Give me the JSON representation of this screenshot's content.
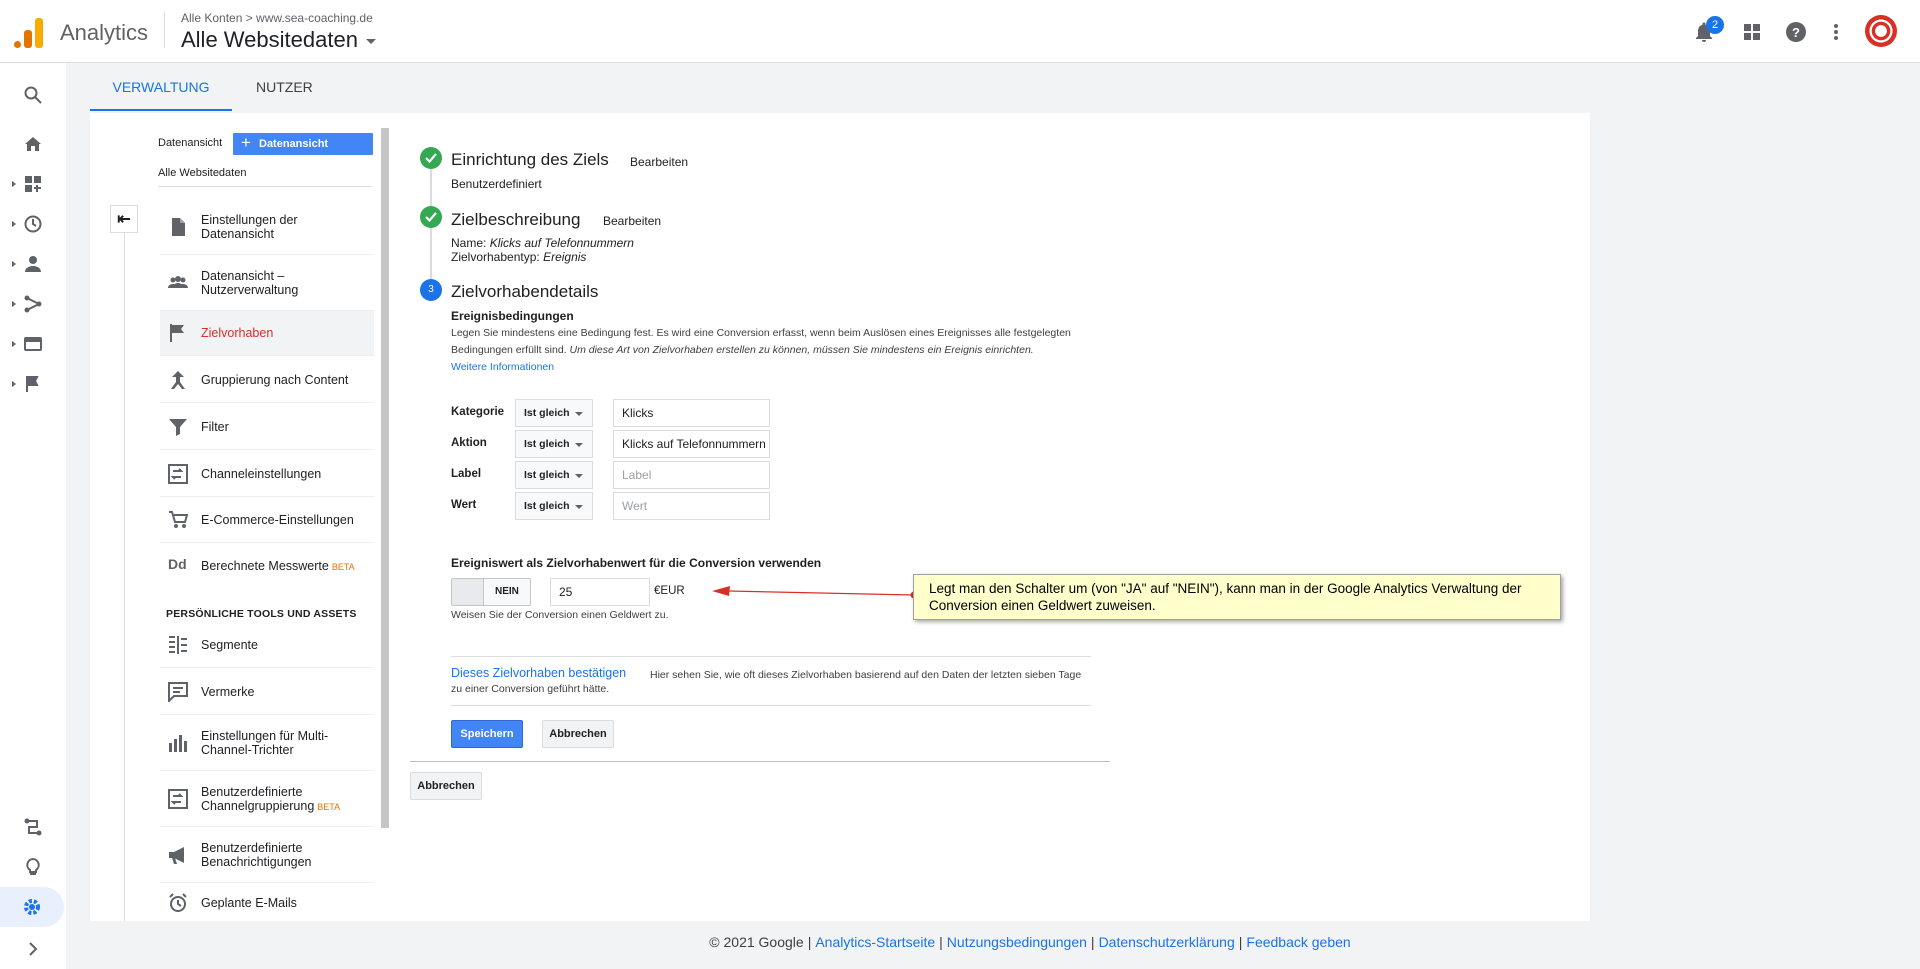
{
  "header": {
    "app_name": "Analytics",
    "breadcrumb": "Alle Konten > www.sea-coaching.de",
    "property": "Alle Websitedaten",
    "notification_count": "2"
  },
  "tabs": [
    {
      "label": "VERWALTUNG",
      "active": true
    },
    {
      "label": "NUTZER",
      "active": false
    }
  ],
  "leftnav": {
    "view_label": "Datenansicht",
    "create_button": "Datenansicht erstellen",
    "view_name": "Alle Websitedaten",
    "items": [
      {
        "label": "Einstellungen der Datenansicht",
        "icon": "document-icon"
      },
      {
        "label": "Datenansicht – Nutzerverwaltung",
        "icon": "people-icon"
      },
      {
        "label": "Zielvorhaben",
        "icon": "flag-icon",
        "active": true
      },
      {
        "label": "Gruppierung nach Content",
        "icon": "grouping-icon"
      },
      {
        "label": "Filter",
        "icon": "filter-icon"
      },
      {
        "label": "Channeleinstellungen",
        "icon": "channel-icon"
      },
      {
        "label": "E-Commerce-Einstellungen",
        "icon": "cart-icon"
      },
      {
        "label": "Berechnete Messwerte",
        "icon": "calculated-metrics-icon",
        "badge": "BETA"
      }
    ],
    "personal_heading": "PERSÖNLICHE TOOLS UND ASSETS",
    "personal_items": [
      {
        "label": "Segmente",
        "icon": "segments-icon"
      },
      {
        "label": "Vermerke",
        "icon": "annotations-icon"
      },
      {
        "label": "Einstellungen für Multi-Channel-Trichter",
        "icon": "bar-chart-icon"
      },
      {
        "label": "Benutzerdefinierte Channelgruppierung",
        "icon": "custom-channel-icon",
        "badge": "BETA"
      },
      {
        "label": "Benutzerdefinierte Benachrichtigungen",
        "icon": "megaphone-icon"
      },
      {
        "label": "Geplante E-Mails",
        "icon": "alarm-clock-icon"
      }
    ]
  },
  "main": {
    "step1": {
      "title": "Einrichtung des Ziels",
      "edit": "Bearbeiten",
      "value": "Benutzerdefiniert"
    },
    "step2": {
      "title": "Zielbeschreibung",
      "edit": "Bearbeiten",
      "name_label": "Name:",
      "name_value": "Klicks auf Telefonnummern",
      "type_label": "Zielvorhabentyp:",
      "type_value": "Ereignis"
    },
    "step3": {
      "number": "3",
      "title": "Zielvorhabendetails",
      "conditions_heading": "Ereignisbedingungen",
      "desc_plain": "Legen Sie mindestens eine Bedingung fest. Es wird eine Conversion erfasst, wenn beim Auslösen eines Ereignisses alle festgelegten Bedingungen erfüllt sind.",
      "desc_italic": "Um diese Art von Zielvorhaben erstellen zu können, müssen Sie mindestens ein Ereignis einrichten.",
      "more_info": "Weitere Informationen",
      "conditions": [
        {
          "label": "Kategorie",
          "operator": "Ist gleich",
          "value": "Klicks",
          "placeholder": ""
        },
        {
          "label": "Aktion",
          "operator": "Ist gleich",
          "value": "Klicks auf Telefonnummern",
          "placeholder": ""
        },
        {
          "label": "Label",
          "operator": "Ist gleich",
          "value": "",
          "placeholder": "Label"
        },
        {
          "label": "Wert",
          "operator": "Ist gleich",
          "value": "",
          "placeholder": "Wert"
        }
      ],
      "value_heading": "Ereigniswert als Zielvorhabenwert für die Conversion verwenden",
      "toggle_label": "NEIN",
      "goal_value": "25",
      "currency": "€EUR",
      "value_hint": "Weisen Sie der Conversion einen Geldwert zu.",
      "verify_link": "Dieses Zielvorhaben bestätigen",
      "verify_desc": "Hier sehen Sie, wie oft dieses Zielvorhaben basierend auf den Daten der letzten sieben Tage zu einer Conversion geführt hätte.",
      "save": "Speichern",
      "cancel": "Abbrechen"
    },
    "cancel_outer": "Abbrechen"
  },
  "annotation": "Legt man den Schalter um (von \"JA\" auf \"NEIN\"), kann man in der Google Analytics Verwaltung der Conversion einen Geldwert zuweisen.",
  "footer": {
    "copyright": "© 2021 Google",
    "links": [
      "Analytics-Startseite",
      "Nutzungsbedingungen",
      "Datenschutzerklärung",
      "Feedback geben"
    ]
  },
  "colors": {
    "accent": "#1a73e8",
    "active_nav": "#d93025",
    "success": "#34a853",
    "callout_bg": "#ffffcc"
  }
}
